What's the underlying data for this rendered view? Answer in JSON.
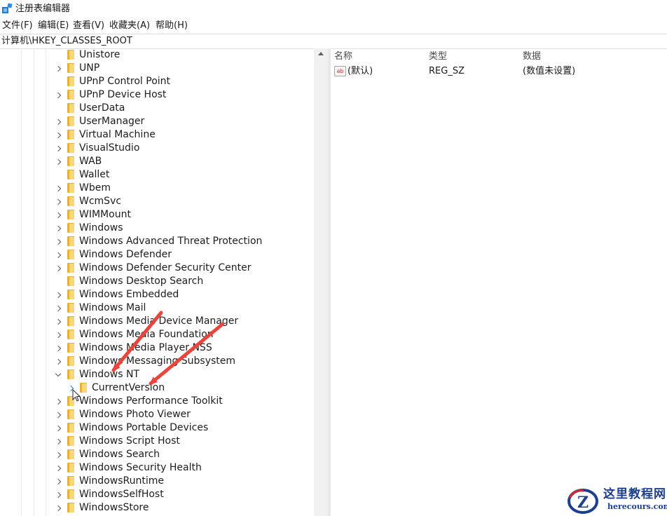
{
  "window": {
    "title": "注册表编辑器",
    "icon": "regedit-icon"
  },
  "menu": [
    {
      "label": "文件(F)"
    },
    {
      "label": "编辑(E)"
    },
    {
      "label": "查看(V)"
    },
    {
      "label": "收藏夹(A)"
    },
    {
      "label": "帮助(H)"
    }
  ],
  "address": {
    "path": "计算机\\HKEY_CLASSES_ROOT"
  },
  "tree": {
    "items": [
      {
        "label": "Unistore",
        "expandable": false
      },
      {
        "label": "UNP",
        "expandable": true
      },
      {
        "label": "UPnP Control Point",
        "expandable": false
      },
      {
        "label": "UPnP Device Host",
        "expandable": true
      },
      {
        "label": "UserData",
        "expandable": false
      },
      {
        "label": "UserManager",
        "expandable": true
      },
      {
        "label": "Virtual Machine",
        "expandable": true
      },
      {
        "label": "VisualStudio",
        "expandable": true
      },
      {
        "label": "WAB",
        "expandable": true
      },
      {
        "label": "Wallet",
        "expandable": false
      },
      {
        "label": "Wbem",
        "expandable": true
      },
      {
        "label": "WcmSvc",
        "expandable": true
      },
      {
        "label": "WIMMount",
        "expandable": true
      },
      {
        "label": "Windows",
        "expandable": true
      },
      {
        "label": "Windows Advanced Threat Protection",
        "expandable": true
      },
      {
        "label": "Windows Defender",
        "expandable": true
      },
      {
        "label": "Windows Defender Security Center",
        "expandable": true
      },
      {
        "label": "Windows Desktop Search",
        "expandable": false
      },
      {
        "label": "Windows Embedded",
        "expandable": true
      },
      {
        "label": "Windows Mail",
        "expandable": true
      },
      {
        "label": "Windows Media Device Manager",
        "expandable": true
      },
      {
        "label": "Windows Media Foundation",
        "expandable": true
      },
      {
        "label": "Windows Media Player NSS",
        "expandable": true
      },
      {
        "label": "Windows Messaging Subsystem",
        "expandable": true
      },
      {
        "label": "Windows NT",
        "expandable": true,
        "expanded": true
      },
      {
        "label": "CurrentVersion",
        "expandable": true,
        "child": true,
        "hover": true
      },
      {
        "label": "Windows Performance Toolkit",
        "expandable": true
      },
      {
        "label": "Windows Photo Viewer",
        "expandable": true
      },
      {
        "label": "Windows Portable Devices",
        "expandable": true
      },
      {
        "label": "Windows Script Host",
        "expandable": true
      },
      {
        "label": "Windows Search",
        "expandable": true
      },
      {
        "label": "Windows Security Health",
        "expandable": true
      },
      {
        "label": "WindowsRuntime",
        "expandable": true
      },
      {
        "label": "WindowsSelfHost",
        "expandable": true
      },
      {
        "label": "WindowsStore",
        "expandable": true
      }
    ]
  },
  "values": {
    "columns": {
      "name": "名称",
      "type": "类型",
      "data": "数据"
    },
    "rows": [
      {
        "icon": "string-value-icon",
        "icon_text": "ab",
        "name": "(默认)",
        "type": "REG_SZ",
        "data": "(数值未设置)"
      }
    ]
  },
  "annotations": {
    "color": "#e8453c",
    "pointing_to": [
      "Windows NT",
      "CurrentVersion"
    ]
  },
  "watermark": {
    "title": "这里教程网",
    "url": "herecours.com"
  },
  "colors": {
    "folder_front": "#f8d775",
    "folder_back": "#e2b13c",
    "hover_chevron": "#1e88d8",
    "watermark_blue": "#1d3f8f"
  }
}
